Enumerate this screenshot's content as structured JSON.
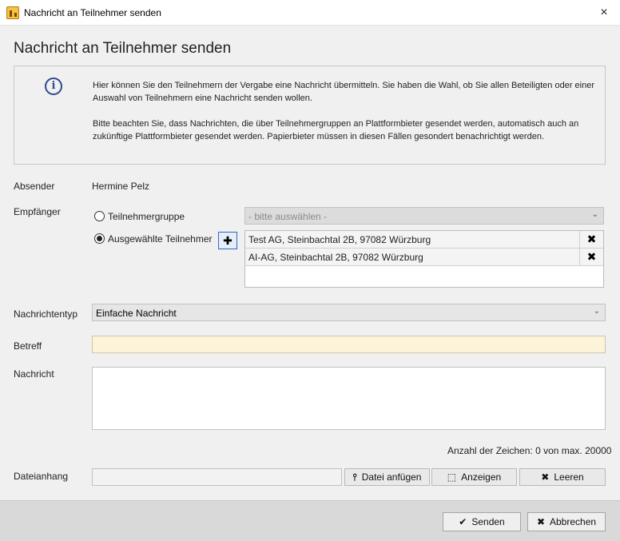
{
  "window": {
    "title": "Nachricht an Teilnehmer senden",
    "close_icon": "×"
  },
  "heading": "Nachricht an Teilnehmer senden",
  "info": {
    "icon": "i",
    "paragraph1": "Hier können Sie den Teilnehmern der Vergabe eine Nachricht übermitteln. Sie haben die Wahl, ob Sie allen Beteiligten oder einer Auswahl von Teilnehmern eine Nachricht senden wollen.",
    "paragraph2": "Bitte beachten Sie, dass Nachrichten, die über Teilnehmergruppen an Plattformbieter gesendet werden, automatisch auch an zukünftige Plattformbieter gesendet werden. Papierbieter müssen in diesen Fällen gesondert benachrichtigt werden."
  },
  "sender": {
    "label": "Absender",
    "value": "Hermine Pelz"
  },
  "recipient": {
    "label": "Empfänger",
    "option_group": "Teilnehmergruppe",
    "option_selected": "Ausgewählte Teilnehmer",
    "group_select_placeholder": "- bitte auswählen -",
    "add_icon": "✚",
    "delete_icon": "✖",
    "list": [
      "Test AG, Steinbachtal 2B, 97082 Würzburg",
      "AI-AG, Steinbachtal 2B, 97082 Würzburg"
    ]
  },
  "message_type": {
    "label": "Nachrichtentyp",
    "value": "Einfache Nachricht"
  },
  "subject": {
    "label": "Betreff",
    "value": ""
  },
  "message": {
    "label": "Nachricht",
    "value": ""
  },
  "char_count": "Anzahl der Zeichen: 0 von max. 20000",
  "attachment": {
    "label": "Dateianhang",
    "attach_label": "Datei anfügen",
    "show_label": "Anzeigen",
    "clear_label": "Leeren",
    "attach_icon": "⫯",
    "show_icon": "⬚",
    "clear_icon": "✖"
  },
  "footer": {
    "send_label": "Senden",
    "cancel_label": "Abbrechen",
    "send_icon": "✔",
    "cancel_icon": "✖"
  }
}
